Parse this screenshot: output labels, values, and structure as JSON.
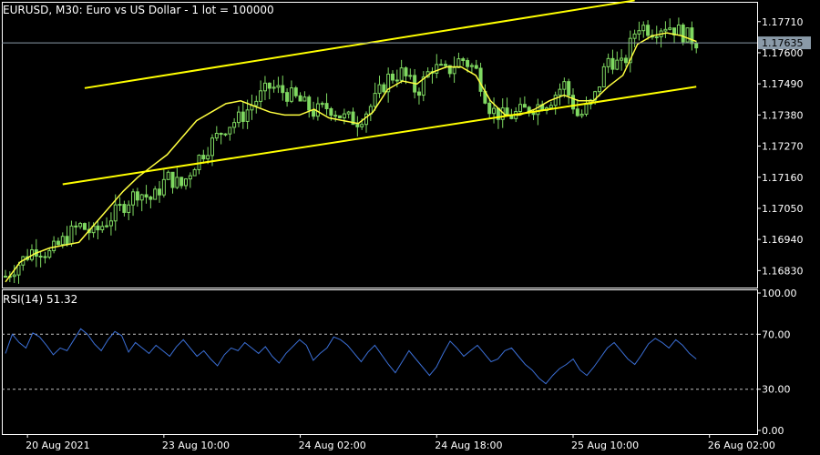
{
  "header": {
    "symbol_info": "EURUSD, M30:  Euro vs US Dollar - 1 lot = 100000"
  },
  "indicator": {
    "label": "RSI(14) 51.32"
  },
  "colors": {
    "background": "#000000",
    "axis": "#ffffff",
    "candle": "#7fd861",
    "ma_line": "#ffff40",
    "channel": "#ffff00",
    "rsi_line": "#3b6fd6",
    "price_line": "#8a9aa8",
    "level_line": "#c0c0c0"
  },
  "chart_data": [
    {
      "type": "candlestick",
      "title": "EURUSD, M30",
      "ylim": [
        1.1677,
        1.1778
      ],
      "ytick_labels": [
        "1.17710",
        "1.17600",
        "1.17490",
        "1.17380",
        "1.17270",
        "1.17160",
        "1.17050",
        "1.16940",
        "1.16830"
      ],
      "yticks": [
        1.1771,
        1.176,
        1.1749,
        1.1738,
        1.1727,
        1.1716,
        1.1705,
        1.1694,
        1.1683
      ],
      "current_price": 1.17635,
      "current_price_label": "1.17635",
      "xtick_labels": [
        "20 Aug 2021",
        "23 Aug 10:00",
        "24 Aug 02:00",
        "24 Aug 18:00",
        "25 Aug 10:00",
        "26 Aug 02:00"
      ],
      "moving_average": {
        "color": "#ffff40",
        "values": [
          1.1679,
          1.1686,
          1.1689,
          1.1691,
          1.1692,
          1.1693,
          1.1699,
          1.1705,
          1.1711,
          1.1716,
          1.172,
          1.1724,
          1.173,
          1.1736,
          1.1739,
          1.1742,
          1.1743,
          1.1741,
          1.1739,
          1.1738,
          1.1738,
          1.174,
          1.1737,
          1.1736,
          1.1735,
          1.1739,
          1.1747,
          1.175,
          1.1749,
          1.1753,
          1.1755,
          1.1755,
          1.1752,
          1.1743,
          1.1738,
          1.1738,
          1.174,
          1.1743,
          1.1745,
          1.1743,
          1.1743,
          1.1748,
          1.1752,
          1.1763,
          1.1766,
          1.1767,
          1.1766,
          1.1764
        ]
      },
      "channel": [
        {
          "name": "upper",
          "start": {
            "bar": 18,
            "price": 1.17475
          },
          "end": {
            "bar": 143,
            "price": 1.17785
          }
        },
        {
          "name": "lower",
          "start": {
            "bar": 13,
            "price": 1.17135
          },
          "end": {
            "bar": 157,
            "price": 1.1748
          }
        }
      ],
      "series": [
        {
          "name": "",
          "close": [
            1.1681,
            1.1686,
            1.1691,
            1.1689,
            1.1694,
            1.1699,
            1.1696,
            1.1701,
            1.1706,
            1.1711,
            1.1708,
            1.1716,
            1.1713,
            1.1722,
            1.1728,
            1.1734,
            1.1737,
            1.1743,
            1.1748,
            1.1746,
            1.1743,
            1.1739,
            1.1741,
            1.1737,
            1.1736,
            1.1742,
            1.1751,
            1.1753,
            1.1746,
            1.1755,
            1.1753,
            1.1758,
            1.1754,
            1.174,
            1.1737,
            1.1739,
            1.1741,
            1.1743,
            1.1749,
            1.1737,
            1.1743,
            1.1758,
            1.1755,
            1.177,
            1.1768,
            1.177,
            1.1767,
            1.1764
          ]
        }
      ]
    },
    {
      "type": "line",
      "title": "RSI(14) 51.32",
      "ylim": [
        0,
        100
      ],
      "ytick_labels": [
        "100.00",
        "70.00",
        "30.00",
        "0.00"
      ],
      "yticks": [
        100,
        70,
        30,
        0
      ],
      "levels": [
        70,
        30
      ],
      "series": [
        {
          "name": "RSI(14)",
          "values": [
            56,
            70,
            64,
            60,
            71,
            68,
            62,
            55,
            60,
            58,
            66,
            74,
            70,
            63,
            58,
            66,
            72,
            69,
            57,
            64,
            60,
            56,
            62,
            58,
            54,
            61,
            66,
            60,
            54,
            58,
            52,
            47,
            55,
            60,
            58,
            64,
            60,
            56,
            61,
            54,
            49,
            56,
            61,
            66,
            62,
            51,
            56,
            60,
            68,
            66,
            62,
            56,
            50,
            57,
            62,
            55,
            48,
            42,
            50,
            58,
            52,
            46,
            40,
            46,
            56,
            65,
            60,
            54,
            58,
            62,
            56,
            50,
            52,
            58,
            60,
            54,
            48,
            44,
            38,
            34,
            40,
            45,
            48,
            52,
            44,
            40,
            46,
            53,
            60,
            64,
            58,
            52,
            48,
            55,
            63,
            67,
            64,
            60,
            66,
            62,
            56,
            52
          ]
        }
      ]
    }
  ]
}
